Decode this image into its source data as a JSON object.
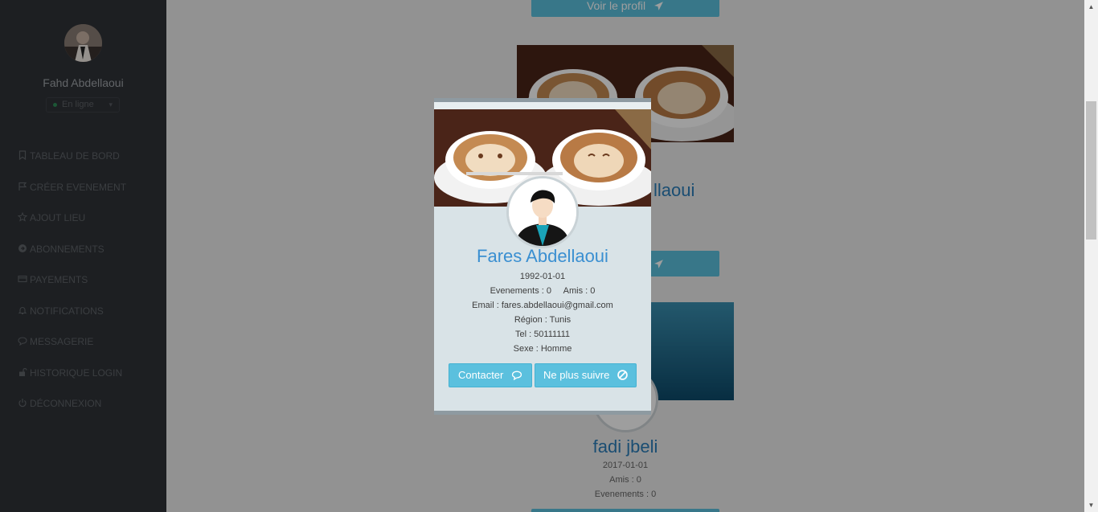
{
  "sidebar": {
    "user_name": "Fahd Abdellaoui",
    "status": "En ligne",
    "items": [
      {
        "label": "Tableau de bord",
        "icon": "bookmark-icon"
      },
      {
        "label": "Créer evenement",
        "icon": "flag-icon"
      },
      {
        "label": "Ajout lieu",
        "icon": "star-icon"
      },
      {
        "label": "Abonnements",
        "icon": "arrow-circle-icon"
      },
      {
        "label": "Payements",
        "icon": "credit-card-icon"
      },
      {
        "label": "Notifications",
        "icon": "bell-icon"
      },
      {
        "label": "Messagerie",
        "icon": "chat-icon"
      },
      {
        "label": "Historique login",
        "icon": "unlock-icon"
      },
      {
        "label": "Déconnexion",
        "icon": "power-icon"
      }
    ]
  },
  "background": {
    "top_button": "Voir le profil",
    "card2_name_fragment": "llaoui",
    "card3": {
      "name": "fadi jbeli",
      "date": "2017-01-01",
      "amis": "Amis : 0",
      "evenements": "Evenements : 0"
    }
  },
  "modal": {
    "name": "Fares Abdellaoui",
    "birthdate": "1992-01-01",
    "counts": "Evenements : 0     Amis : 0",
    "email": "Email : fares.abdellaoui@gmail.com",
    "region": "Région : Tunis",
    "tel": "Tel : 50111111",
    "sexe": "Sexe : Homme",
    "contact_button": "Contacter",
    "unfollow_button": "Ne plus suivre"
  },
  "colors": {
    "sidebar_bg": "#2f3237",
    "accent": "#5bc0de",
    "name_blue": "#3a8fd1",
    "modal_bg": "#d9e3e7"
  }
}
